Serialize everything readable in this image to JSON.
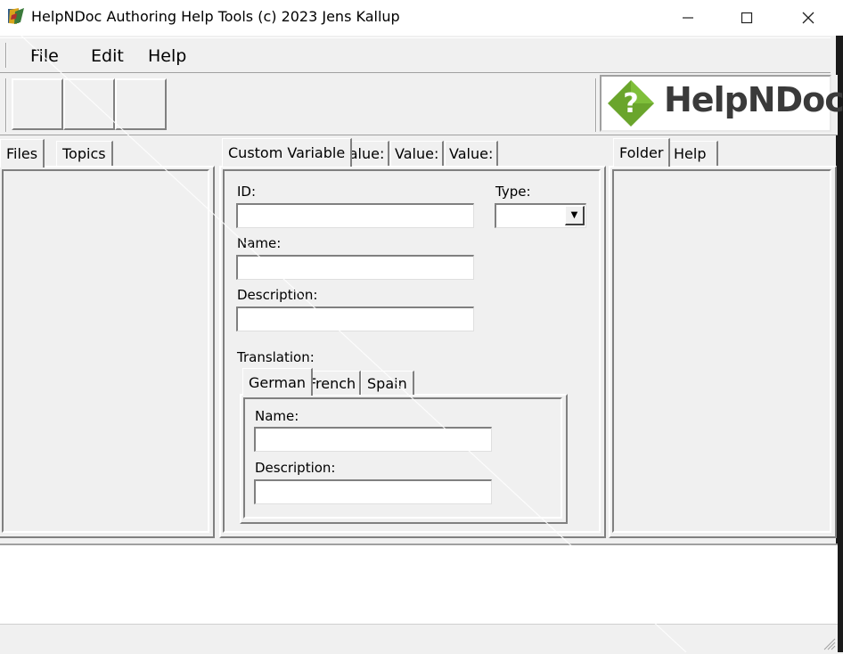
{
  "window": {
    "title": "HelpNDoc Authoring Help Tools (c) 2023 Jens Kallup",
    "minimize_icon": "minimize-icon",
    "maximize_icon": "maximize-icon",
    "close_icon": "close-icon"
  },
  "menu": {
    "items": [
      {
        "label": "File"
      },
      {
        "label": "Edit"
      },
      {
        "label": "Help"
      }
    ]
  },
  "logo": {
    "text": "HelpNDoc",
    "brand_green": "#6aa52c"
  },
  "left_panel": {
    "tabs": [
      {
        "label": "Files"
      },
      {
        "label": "Topics"
      }
    ]
  },
  "center_panel": {
    "tabs": [
      {
        "label": "Custom Variable"
      },
      {
        "label": "Value:"
      },
      {
        "label": "Value:"
      },
      {
        "label": "Value:"
      }
    ],
    "id_label": "ID:",
    "id_value": "",
    "type_label": "Type:",
    "type_value": "",
    "name_label": "Name:",
    "name_value": "",
    "description_label": "Description:",
    "description_value": "",
    "translation_label": "Translation:",
    "translation_tabs": [
      {
        "label": "German"
      },
      {
        "label": "French"
      },
      {
        "label": "Spain"
      }
    ],
    "translation": {
      "name_label": "Name:",
      "name_value": "",
      "description_label": "Description:",
      "description_value": ""
    }
  },
  "right_panel": {
    "tabs": [
      {
        "label": "Folder"
      },
      {
        "label": "Help"
      }
    ]
  }
}
